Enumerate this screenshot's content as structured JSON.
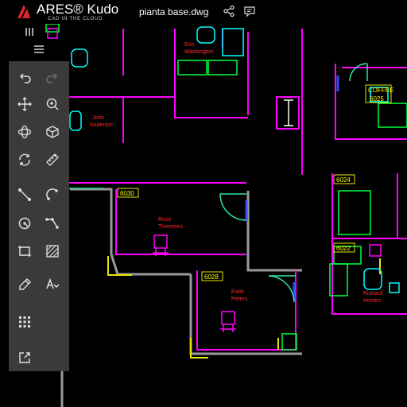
{
  "header": {
    "brand": "ARES® Kudo",
    "tagline": "CAD IN THE CLOUD",
    "file_name": "pianta base.dwg",
    "icons": [
      "share-icon",
      "comment-icon"
    ]
  },
  "toolbar": {
    "items": [
      "undo-icon",
      "redo-icon",
      "pan-icon",
      "zoom-icon",
      "orbit-icon",
      "view-cube-icon",
      "refresh-icon",
      "measure-icon",
      "line-icon",
      "arc-icon",
      "circle-icon",
      "polyline-icon",
      "rectangle-icon",
      "hatch-icon",
      "edit-icon",
      "text-icon",
      "grid-icon",
      "export-icon"
    ]
  },
  "drawing": {
    "rooms": [
      "6030",
      "6028",
      "6024",
      "6022",
      "6025"
    ],
    "coffee_label": "COFFEE",
    "names": [
      [
        "Erin",
        "Washington"
      ],
      [
        "John",
        "Anderson"
      ],
      [
        "Rose",
        "Thommes"
      ],
      [
        "Ester",
        "Peters"
      ],
      [
        "Richard",
        "Homes"
      ]
    ]
  },
  "colors": {
    "wall": "#ff00ff",
    "furniture": "#00ffff",
    "desk": "#00ff3c",
    "door": "#2ee6a0",
    "tag": "#ffff00",
    "name": "#ff2a2a",
    "toolbar_bg": "#3a3a3a"
  }
}
